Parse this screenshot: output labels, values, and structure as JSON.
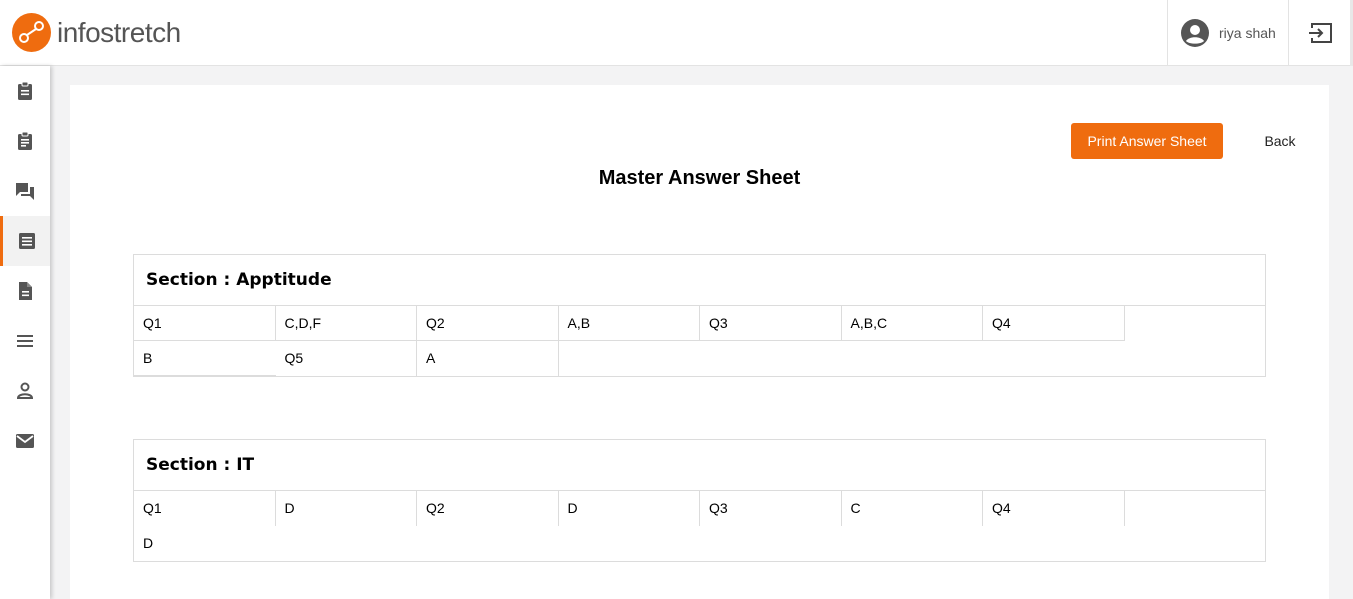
{
  "app": {
    "brand": "infostretch"
  },
  "header": {
    "user_name": "riya shah",
    "logout_icon": "logout-icon"
  },
  "sidebar": {
    "items": [
      {
        "icon": "clipboard-icon",
        "active": false
      },
      {
        "icon": "clipboard-list-icon",
        "active": false
      },
      {
        "icon": "forum-icon",
        "active": false
      },
      {
        "icon": "answer-sheet-icon",
        "active": true
      },
      {
        "icon": "document-icon",
        "active": false
      },
      {
        "icon": "menu-icon",
        "active": false
      },
      {
        "icon": "person-icon",
        "active": false
      },
      {
        "icon": "mail-icon",
        "active": false
      }
    ]
  },
  "page": {
    "title": "Master Answer Sheet",
    "print_label": "Print Answer Sheet",
    "back_label": "Back"
  },
  "sections": [
    {
      "title": "Section : Apptitude",
      "answers": [
        {
          "q": "Q1",
          "a": "C,D,F"
        },
        {
          "q": "Q2",
          "a": "A,B"
        },
        {
          "q": "Q3",
          "a": "A,B,C"
        },
        {
          "q": "Q4",
          "a": "B"
        },
        {
          "q": "Q5",
          "a": "A"
        }
      ]
    },
    {
      "title": "Section : IT",
      "answers": [
        {
          "q": "Q1",
          "a": "D"
        },
        {
          "q": "Q2",
          "a": "D"
        },
        {
          "q": "Q3",
          "a": "C"
        },
        {
          "q": "Q4",
          "a": "D"
        }
      ]
    }
  ],
  "colors": {
    "accent": "#ef6c0f",
    "icon": "#555555"
  }
}
